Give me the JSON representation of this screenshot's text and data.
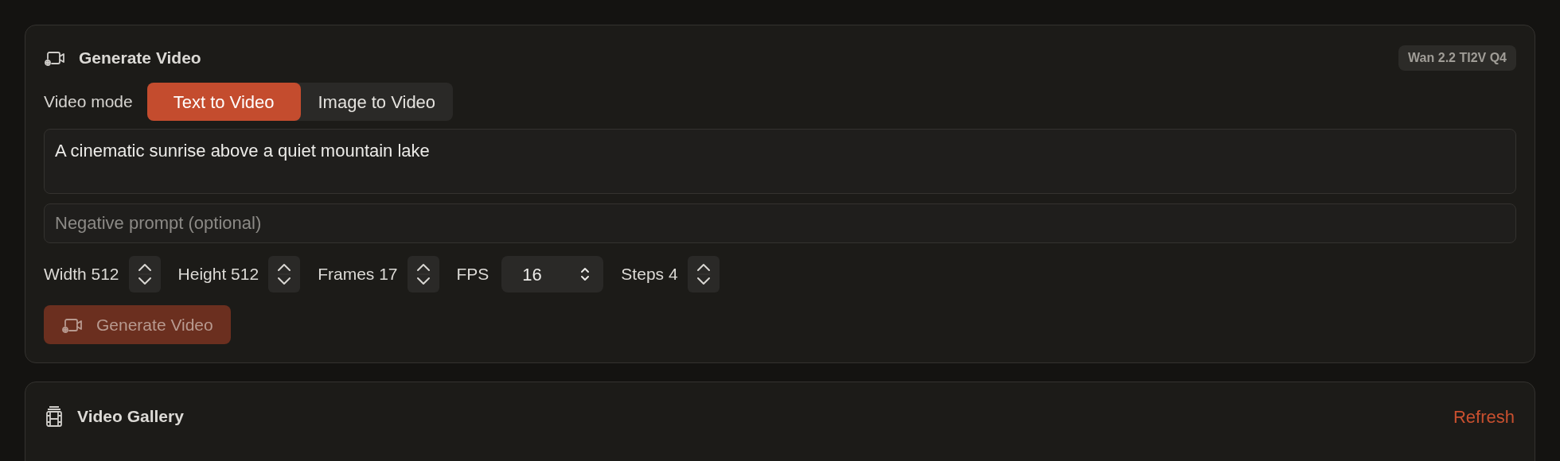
{
  "generate_panel": {
    "title": "Generate Video",
    "model_badge": "Wan 2.2 TI2V Q4",
    "mode_label": "Video mode",
    "modes": [
      {
        "label": "Text to Video",
        "selected": true
      },
      {
        "label": "Image to Video",
        "selected": false
      }
    ],
    "prompt": {
      "value": "A cinematic sunrise above a quiet mountain lake"
    },
    "negative_prompt": {
      "placeholder": "Negative prompt (optional)"
    },
    "params": [
      {
        "kind": "stepper",
        "label": "Width 512"
      },
      {
        "kind": "stepper",
        "label": "Height 512"
      },
      {
        "kind": "stepper",
        "label": "Frames 17"
      },
      {
        "kind": "select",
        "label": "FPS",
        "value": "16"
      },
      {
        "kind": "stepper",
        "label": "Steps 4"
      }
    ],
    "generate_button": {
      "label": "Generate Video",
      "disabled": true
    }
  },
  "gallery_panel": {
    "title": "Video Gallery",
    "refresh": "Refresh"
  }
}
